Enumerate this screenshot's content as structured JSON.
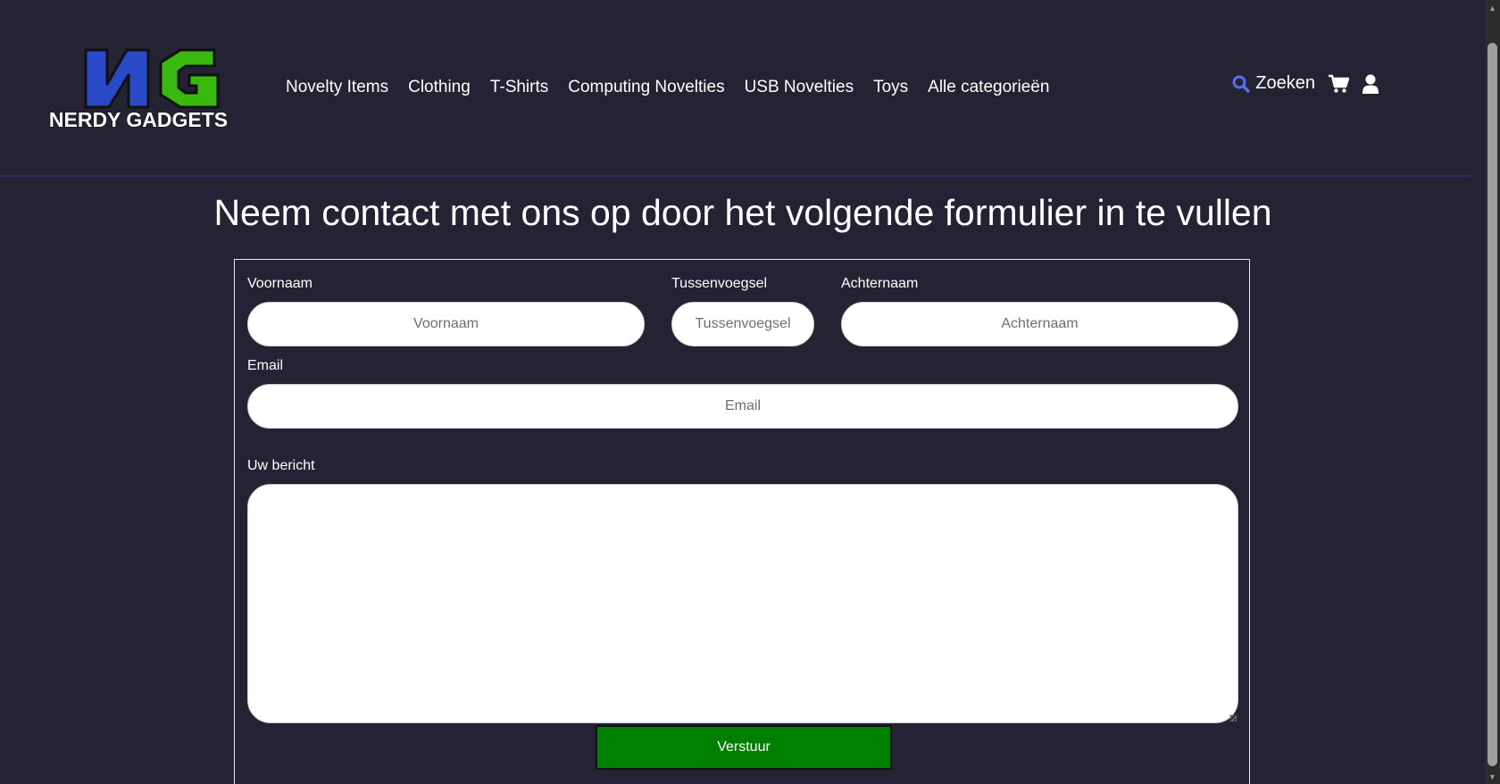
{
  "brand": {
    "logo_letters": "NG",
    "logo_text": "NERDY GADGETS",
    "logo_colors": {
      "n": "#2a49c7",
      "g": "#39b80f",
      "outline": "#111111"
    }
  },
  "nav": {
    "items": [
      {
        "label": "Novelty Items"
      },
      {
        "label": "Clothing"
      },
      {
        "label": "T-Shirts"
      },
      {
        "label": "Computing Novelties"
      },
      {
        "label": "USB Novelties"
      },
      {
        "label": "Toys"
      },
      {
        "label": "Alle categorieën"
      }
    ]
  },
  "tools": {
    "search_label": "Zoeken",
    "search_icon": "search-icon",
    "cart_icon": "cart-icon",
    "user_icon": "user-icon",
    "search_icon_color": "#5b6cf0"
  },
  "page": {
    "title": "Neem contact met ons op door het volgende formulier in te vullen"
  },
  "form": {
    "voornaam": {
      "label": "Voornaam",
      "placeholder": "Voornaam",
      "value": ""
    },
    "tussenvoegsel": {
      "label": "Tussenvoegsel",
      "placeholder": "Tussenvoegsel",
      "value": ""
    },
    "achternaam": {
      "label": "Achternaam",
      "placeholder": "Achternaam",
      "value": ""
    },
    "email": {
      "label": "Email",
      "placeholder": "Email",
      "value": ""
    },
    "bericht": {
      "label": "Uw bericht",
      "value": ""
    },
    "submit_label": "Verstuur",
    "submit_color": "#008000"
  },
  "colors": {
    "background": "#232333",
    "header_divider": "#2e2b5a"
  }
}
